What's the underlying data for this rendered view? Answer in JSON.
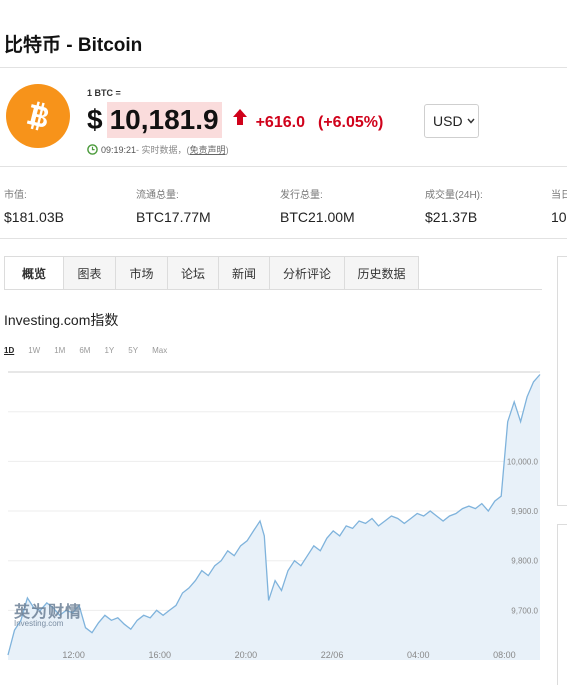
{
  "header": {
    "title": "比特币 - Bitcoin"
  },
  "quote": {
    "unit_label": "1 BTC =",
    "currency_symbol": "$",
    "price": "10,181.9",
    "change_abs": "+616.0",
    "change_pct": "(+6.05%)",
    "time": "09:19:21",
    "status_text": " - 实时数据，(",
    "disclaimer": "免责声明",
    "status_close": ")",
    "currency": "USD"
  },
  "stats": [
    {
      "label": "市值:",
      "value": "$181.03B"
    },
    {
      "label": "流通总量:",
      "value": "BTC17.77M"
    },
    {
      "label": "发行总量:",
      "value": "BTC21.00M"
    },
    {
      "label": "成交量(24H):",
      "value": "$21.37B"
    },
    {
      "label": "当日",
      "value": "10"
    }
  ],
  "tabs": [
    "概览",
    "图表",
    "市场",
    "论坛",
    "新闻",
    "分析评论",
    "历史数据"
  ],
  "index_title": "Investing.com指数",
  "ranges": [
    "1D",
    "1W",
    "1M",
    "6M",
    "1Y",
    "5Y",
    "Max"
  ],
  "watermark": {
    "cn": "英为财情",
    "en": "Investing.com"
  },
  "colors": {
    "accent_red": "#d0021b",
    "bitcoin_orange": "#f7931a",
    "line_blue": "#7fb3dc",
    "area_fill": "#e8f1f9"
  },
  "chart_data": {
    "type": "area",
    "x_tick_labels": [
      "12:00",
      "16:00",
      "20:00",
      "22/06",
      "04:00",
      "08:00"
    ],
    "y_tick_labels": [
      "9,700.0",
      "9,800.0",
      "9,900.0",
      "10,000.0"
    ],
    "ylim": [
      9600,
      10180
    ],
    "grid": true,
    "series": [
      {
        "points": [
          [
            0,
            9610
          ],
          [
            0.3,
            9660
          ],
          [
            0.6,
            9680
          ],
          [
            0.9,
            9725
          ],
          [
            1.2,
            9705
          ],
          [
            1.5,
            9700
          ],
          [
            1.8,
            9715
          ],
          [
            2.1,
            9705
          ],
          [
            2.4,
            9690
          ],
          [
            2.7,
            9700
          ],
          [
            3.0,
            9695
          ],
          [
            3.3,
            9710
          ],
          [
            3.6,
            9665
          ],
          [
            3.9,
            9655
          ],
          [
            4.2,
            9675
          ],
          [
            4.5,
            9690
          ],
          [
            4.8,
            9680
          ],
          [
            5.1,
            9685
          ],
          [
            5.4,
            9672
          ],
          [
            5.7,
            9662
          ],
          [
            6.0,
            9680
          ],
          [
            6.3,
            9690
          ],
          [
            6.6,
            9685
          ],
          [
            6.9,
            9700
          ],
          [
            7.2,
            9690
          ],
          [
            7.5,
            9700
          ],
          [
            7.8,
            9710
          ],
          [
            8.1,
            9735
          ],
          [
            8.4,
            9745
          ],
          [
            8.7,
            9760
          ],
          [
            9.0,
            9780
          ],
          [
            9.3,
            9770
          ],
          [
            9.6,
            9790
          ],
          [
            9.9,
            9800
          ],
          [
            10.2,
            9820
          ],
          [
            10.5,
            9810
          ],
          [
            10.8,
            9830
          ],
          [
            11.1,
            9840
          ],
          [
            11.4,
            9860
          ],
          [
            11.7,
            9880
          ],
          [
            11.9,
            9850
          ],
          [
            12.1,
            9720
          ],
          [
            12.4,
            9760
          ],
          [
            12.7,
            9740
          ],
          [
            13.0,
            9780
          ],
          [
            13.3,
            9800
          ],
          [
            13.6,
            9790
          ],
          [
            13.9,
            9810
          ],
          [
            14.2,
            9830
          ],
          [
            14.5,
            9820
          ],
          [
            14.8,
            9845
          ],
          [
            15.1,
            9860
          ],
          [
            15.4,
            9850
          ],
          [
            15.7,
            9870
          ],
          [
            16.0,
            9865
          ],
          [
            16.3,
            9880
          ],
          [
            16.6,
            9875
          ],
          [
            16.9,
            9885
          ],
          [
            17.2,
            9870
          ],
          [
            17.5,
            9880
          ],
          [
            17.8,
            9890
          ],
          [
            18.1,
            9885
          ],
          [
            18.4,
            9875
          ],
          [
            18.7,
            9885
          ],
          [
            19.0,
            9895
          ],
          [
            19.3,
            9890
          ],
          [
            19.6,
            9900
          ],
          [
            19.9,
            9890
          ],
          [
            20.2,
            9880
          ],
          [
            20.5,
            9890
          ],
          [
            20.8,
            9895
          ],
          [
            21.1,
            9905
          ],
          [
            21.4,
            9910
          ],
          [
            21.7,
            9905
          ],
          [
            22.0,
            9915
          ],
          [
            22.3,
            9900
          ],
          [
            22.6,
            9920
          ],
          [
            22.9,
            9930
          ],
          [
            23.2,
            10080
          ],
          [
            23.5,
            10120
          ],
          [
            23.8,
            10080
          ],
          [
            24.1,
            10130
          ],
          [
            24.4,
            10160
          ],
          [
            24.7,
            10175
          ]
        ]
      }
    ]
  }
}
